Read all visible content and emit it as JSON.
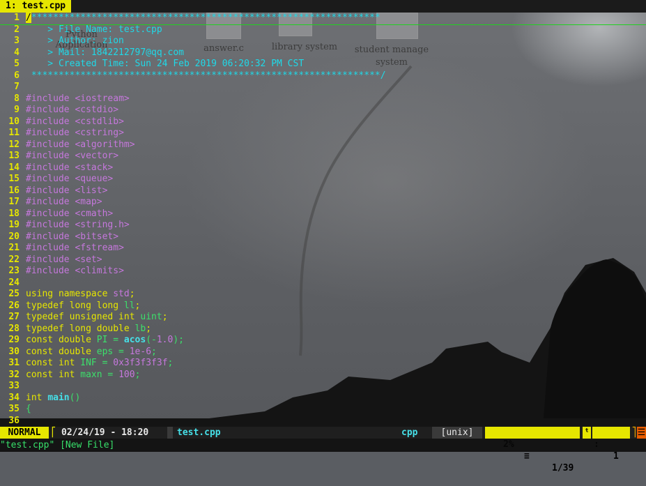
{
  "tab": {
    "label": "1: test.cpp"
  },
  "desktop_icons": [
    {
      "label": "Python Application"
    },
    {
      "label": "answer.c"
    },
    {
      "label": "library system"
    },
    {
      "label": "student manage system"
    }
  ],
  "lines": [
    {
      "n": "1",
      "segs": [
        [
          "cursor",
          "/"
        ],
        [
          "cmt",
          "****************************************************************"
        ]
      ]
    },
    {
      "n": "2",
      "segs": [
        [
          "cmt",
          "    > File Name: test.cpp"
        ]
      ]
    },
    {
      "n": "3",
      "segs": [
        [
          "cmt",
          "    > Author: zion"
        ]
      ]
    },
    {
      "n": "4",
      "segs": [
        [
          "cmt",
          "    > Mail: 1842212797@qq.com"
        ]
      ]
    },
    {
      "n": "5",
      "segs": [
        [
          "cmt",
          "    > Created Time: Sun 24 Feb 2019 06:20:32 PM CST"
        ]
      ]
    },
    {
      "n": "6",
      "segs": [
        [
          "cmt",
          " ****************************************************************/"
        ]
      ]
    },
    {
      "n": "7",
      "segs": []
    },
    {
      "n": "8",
      "segs": [
        [
          "pp",
          "#include "
        ],
        [
          "inc",
          "<iostream>"
        ]
      ]
    },
    {
      "n": "9",
      "segs": [
        [
          "pp",
          "#include "
        ],
        [
          "inc",
          "<cstdio>"
        ]
      ]
    },
    {
      "n": "10",
      "segs": [
        [
          "pp",
          "#include "
        ],
        [
          "inc",
          "<cstdlib>"
        ]
      ]
    },
    {
      "n": "11",
      "segs": [
        [
          "pp",
          "#include "
        ],
        [
          "inc",
          "<cstring>"
        ]
      ]
    },
    {
      "n": "12",
      "segs": [
        [
          "pp",
          "#include "
        ],
        [
          "inc",
          "<algorithm>"
        ]
      ]
    },
    {
      "n": "13",
      "segs": [
        [
          "pp",
          "#include "
        ],
        [
          "inc",
          "<vector>"
        ]
      ]
    },
    {
      "n": "14",
      "segs": [
        [
          "pp",
          "#include "
        ],
        [
          "inc",
          "<stack>"
        ]
      ]
    },
    {
      "n": "15",
      "segs": [
        [
          "pp",
          "#include "
        ],
        [
          "inc",
          "<queue>"
        ]
      ]
    },
    {
      "n": "16",
      "segs": [
        [
          "pp",
          "#include "
        ],
        [
          "inc",
          "<list>"
        ]
      ]
    },
    {
      "n": "17",
      "segs": [
        [
          "pp",
          "#include "
        ],
        [
          "inc",
          "<map>"
        ]
      ]
    },
    {
      "n": "18",
      "segs": [
        [
          "pp",
          "#include "
        ],
        [
          "inc",
          "<cmath>"
        ]
      ]
    },
    {
      "n": "19",
      "segs": [
        [
          "pp",
          "#include "
        ],
        [
          "inc",
          "<string.h>"
        ]
      ]
    },
    {
      "n": "20",
      "segs": [
        [
          "pp",
          "#include "
        ],
        [
          "inc",
          "<bitset>"
        ]
      ]
    },
    {
      "n": "21",
      "segs": [
        [
          "pp",
          "#include "
        ],
        [
          "inc",
          "<fstream>"
        ]
      ]
    },
    {
      "n": "22",
      "segs": [
        [
          "pp",
          "#include "
        ],
        [
          "inc",
          "<set>"
        ]
      ]
    },
    {
      "n": "23",
      "segs": [
        [
          "pp",
          "#include "
        ],
        [
          "inc",
          "<climits>"
        ]
      ]
    },
    {
      "n": "24",
      "segs": []
    },
    {
      "n": "25",
      "segs": [
        [
          "kw",
          "using namespace "
        ],
        [
          "inc",
          "std"
        ],
        [
          "kw",
          ";"
        ]
      ]
    },
    {
      "n": "26",
      "segs": [
        [
          "ty",
          "typedef long long "
        ],
        [
          "ident",
          "ll"
        ],
        [
          "ty",
          ";"
        ]
      ]
    },
    {
      "n": "27",
      "segs": [
        [
          "ty",
          "typedef unsigned int "
        ],
        [
          "ident",
          "uint"
        ],
        [
          "ty",
          ";"
        ]
      ]
    },
    {
      "n": "28",
      "segs": [
        [
          "ty",
          "typedef long double "
        ],
        [
          "ident",
          "lb"
        ],
        [
          "ty",
          ";"
        ]
      ]
    },
    {
      "n": "29",
      "segs": [
        [
          "ty",
          "const double "
        ],
        [
          "ident",
          "PI = "
        ],
        [
          "fn",
          "acos"
        ],
        [
          "ident",
          "(-"
        ],
        [
          "num",
          "1.0"
        ],
        [
          "ident",
          ");"
        ]
      ]
    },
    {
      "n": "30",
      "segs": [
        [
          "ty",
          "const double "
        ],
        [
          "ident",
          "eps = "
        ],
        [
          "num",
          "1e-6"
        ],
        [
          "ident",
          ";"
        ]
      ]
    },
    {
      "n": "31",
      "segs": [
        [
          "ty",
          "const int "
        ],
        [
          "ident",
          "INF = "
        ],
        [
          "num",
          "0x3f3f3f3f"
        ],
        [
          "ident",
          ";"
        ]
      ]
    },
    {
      "n": "32",
      "segs": [
        [
          "ty",
          "const int "
        ],
        [
          "ident",
          "maxn = "
        ],
        [
          "num",
          "100"
        ],
        [
          "ident",
          ";"
        ]
      ]
    },
    {
      "n": "33",
      "segs": []
    },
    {
      "n": "34",
      "segs": [
        [
          "ty",
          "int "
        ],
        [
          "fn",
          "main"
        ],
        [
          "ident",
          "()"
        ]
      ]
    },
    {
      "n": "35",
      "segs": [
        [
          "ident",
          "{"
        ]
      ]
    },
    {
      "n": "36",
      "segs": []
    }
  ],
  "statusline": {
    "mode": "NORMAL",
    "datetime": "02/24/19 - 18:20",
    "filename": "test.cpp",
    "filetype": "cpp",
    "fileformat": "[unix]",
    "percent": "2%",
    "position": "1/39",
    "column": "1"
  },
  "cmdline": "\"test.cpp\" [New File]"
}
